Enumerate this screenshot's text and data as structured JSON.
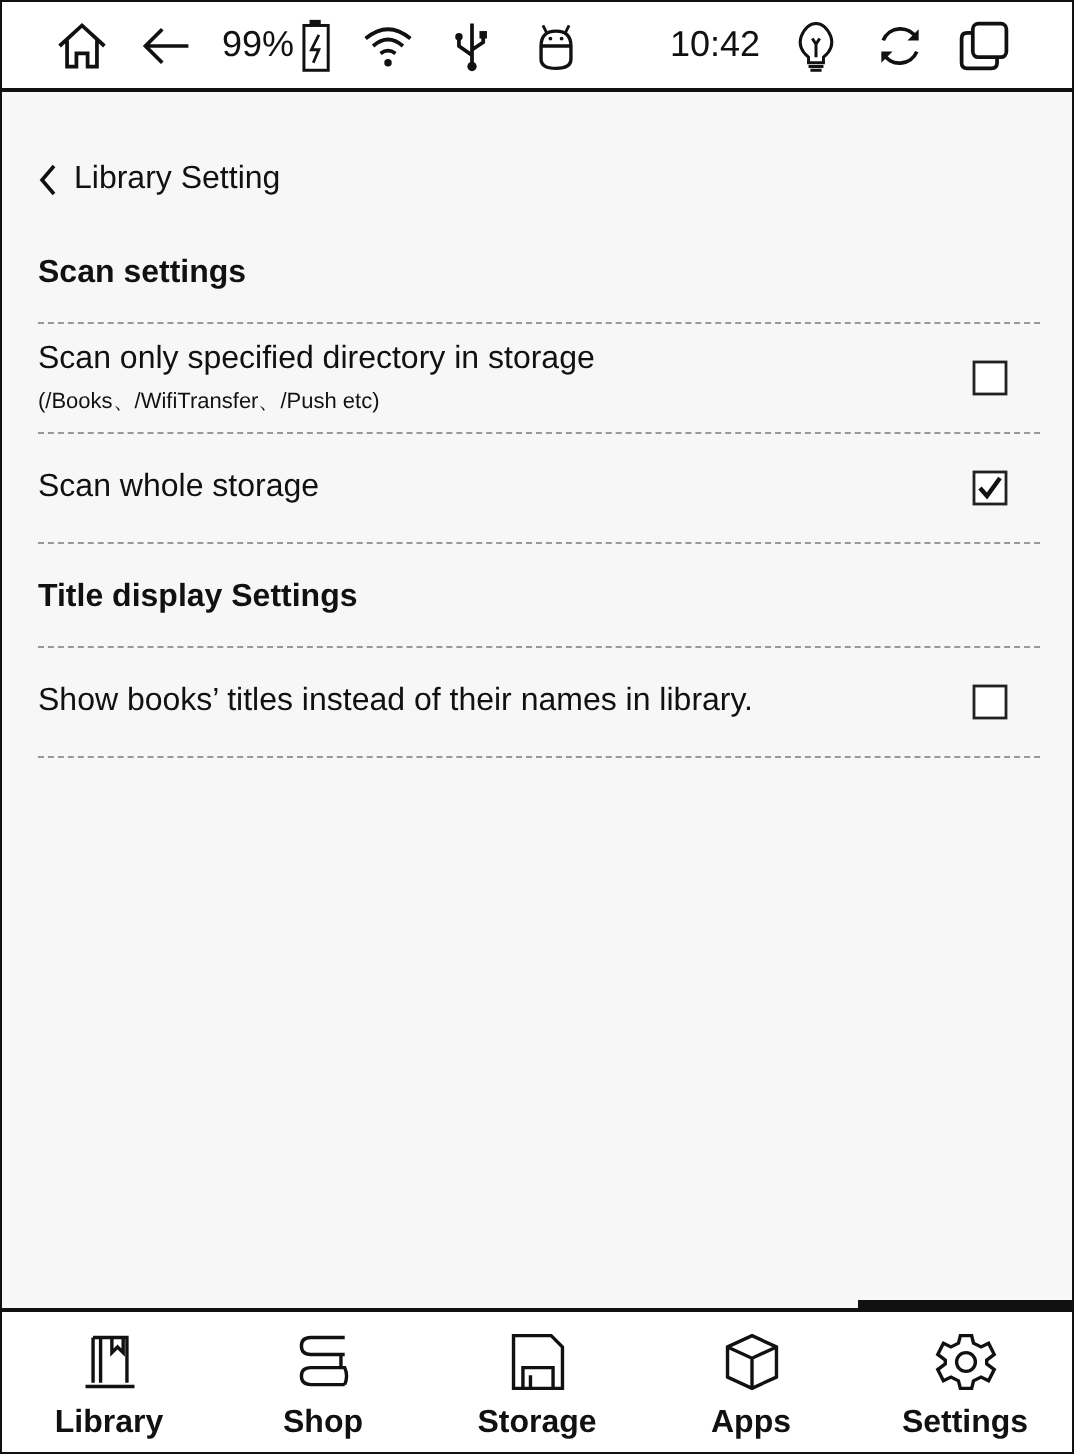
{
  "status_bar": {
    "battery": "99%",
    "time": "10:42"
  },
  "header": {
    "title": "Library Setting"
  },
  "sections": [
    {
      "title": "Scan settings",
      "items": [
        {
          "label": "Scan only specified directory in storage",
          "sublabel": "(/Books、/WifiTransfer、/Push etc)",
          "checked": false
        },
        {
          "label": "Scan whole storage",
          "checked": true
        }
      ]
    },
    {
      "title": "Title display Settings",
      "items": [
        {
          "label": "Show books’ titles instead of their names in library.",
          "checked": false
        }
      ]
    }
  ],
  "nav": [
    {
      "label": "Library",
      "kind": "library",
      "selected": false
    },
    {
      "label": "Shop",
      "kind": "shop",
      "selected": false
    },
    {
      "label": "Storage",
      "kind": "storage",
      "selected": false
    },
    {
      "label": "Apps",
      "kind": "apps",
      "selected": false
    },
    {
      "label": "Settings",
      "kind": "settings",
      "selected": true
    }
  ]
}
